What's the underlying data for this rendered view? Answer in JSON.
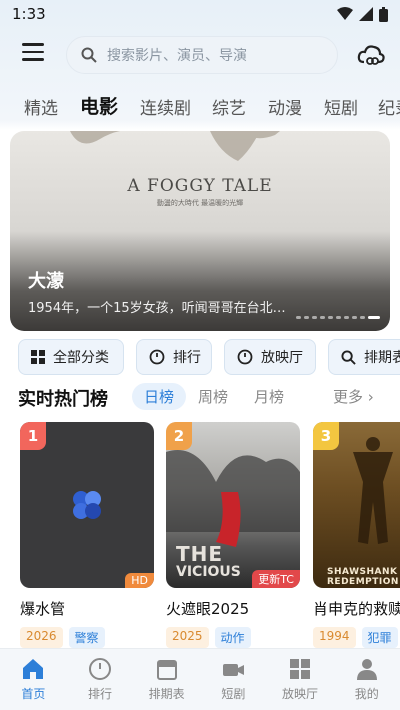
{
  "status": {
    "time": "1:33"
  },
  "search": {
    "placeholder": "搜索影片、演员、导演"
  },
  "tabs": [
    "精选",
    "电影",
    "连续剧",
    "综艺",
    "动漫",
    "短剧",
    "纪录"
  ],
  "banner": {
    "poster_title": "A FOGGY TALE",
    "poster_sub": "動盪的大時代 最温暖的光輝",
    "title": "大濛",
    "desc": "1954年，一个15岁女孩，听闻哥哥在台北…"
  },
  "chips": [
    "全部分类",
    "排行",
    "放映厅",
    "排期表"
  ],
  "ranking": {
    "title": "实时热门榜",
    "tabs": [
      "日榜",
      "周榜",
      "月榜"
    ],
    "more": "更多"
  },
  "cards": [
    {
      "rank": "1",
      "name": "爆水管",
      "quality": "HD",
      "year": "2026",
      "genre": "警察",
      "rank_color": "#f2665c"
    },
    {
      "rank": "2",
      "name": "火遮眼2025",
      "quality": "更新TC",
      "year": "2025",
      "genre": "动作",
      "rank_color": "#f0a14a"
    },
    {
      "rank": "3",
      "name": "肖申克的救赎",
      "quality": "",
      "year": "1994",
      "genre": "犯罪",
      "rank_color": "#f3c640"
    }
  ],
  "poster_text": {
    "p2_a": "THE",
    "p2_b": "VICIOUS",
    "p3": "SHAWSHANK REDEMPTION"
  },
  "nav": [
    "首页",
    "排行",
    "排期表",
    "短剧",
    "放映厅",
    "我的"
  ],
  "colors": {
    "accent": "#2d7fd8",
    "rank1": "#f2665c",
    "rank2": "#f0a14a",
    "rank3": "#f3c640"
  }
}
